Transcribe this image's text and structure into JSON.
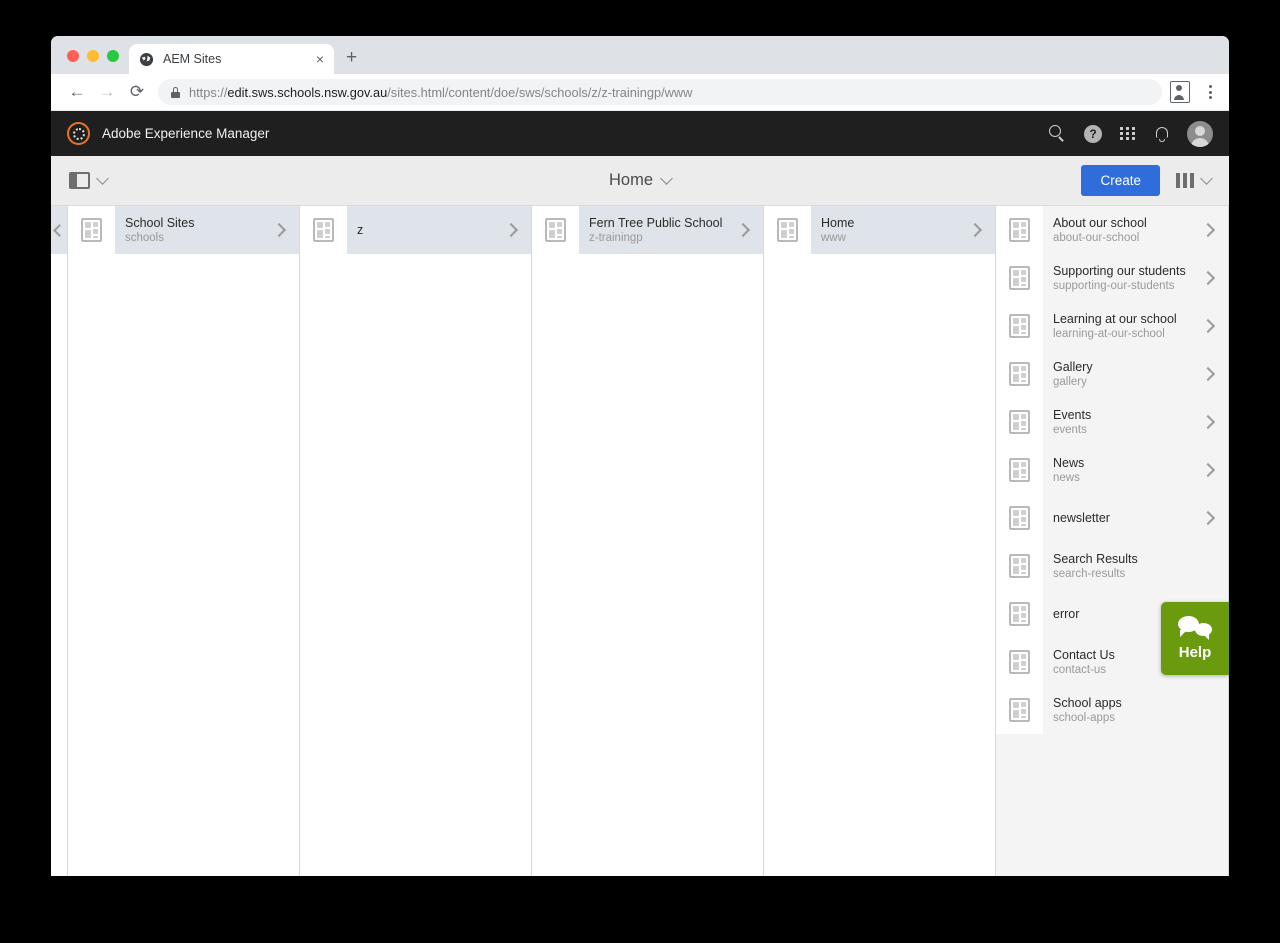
{
  "browser": {
    "tab_title": "AEM Sites",
    "tab_close_label": "×",
    "newtab_label": "+",
    "back_label": "←",
    "forward_label": "→",
    "reload_label": "⟳",
    "url_scheme": "https://",
    "url_domain": "edit.sws.schools.nsw.gov.au",
    "url_path": "/sites.html/content/doe/sws/schools/z/z-trainingp/www",
    "url_full": "https://edit.sws.schools.nsw.gov.au/sites.html/content/doe/sws/schools/z/z-trainingp/www"
  },
  "aem_header": {
    "title": "Adobe Experience Manager",
    "logo_color": "#e8732a",
    "background": "#1f1f1f",
    "icons": [
      "search-icon",
      "help-icon",
      "apps-grid-icon",
      "bell-icon",
      "user-avatar"
    ],
    "help_glyph": "?"
  },
  "toolbar": {
    "rail_toggle_label": "rail-toggle",
    "title": "Home",
    "create_label": "Create",
    "view_switch_label": "column-view"
  },
  "columns": [
    {
      "name": "schools-column",
      "rows": [
        {
          "title": "School Sites",
          "subtitle": "schools",
          "selected": true,
          "has_chevron": true
        }
      ]
    },
    {
      "name": "z-column",
      "rows": [
        {
          "title": "z",
          "subtitle": "",
          "selected": true,
          "has_chevron": true
        }
      ]
    },
    {
      "name": "school-column",
      "rows": [
        {
          "title": "Fern Tree Public School",
          "subtitle": "z-trainingp",
          "selected": true,
          "has_chevron": true
        }
      ]
    },
    {
      "name": "site-column",
      "rows": [
        {
          "title": "Home",
          "subtitle": "www",
          "selected": true,
          "has_chevron": true
        }
      ]
    }
  ],
  "page_list": {
    "name": "children-column",
    "items": [
      {
        "title": "About our school",
        "subtitle": "about-our-school",
        "has_chevron": true
      },
      {
        "title": "Supporting our students",
        "subtitle": "supporting-our-students",
        "has_chevron": true
      },
      {
        "title": "Learning at our school",
        "subtitle": "learning-at-our-school",
        "has_chevron": true
      },
      {
        "title": "Gallery",
        "subtitle": "gallery",
        "has_chevron": true
      },
      {
        "title": "Events",
        "subtitle": "events",
        "has_chevron": true
      },
      {
        "title": "News",
        "subtitle": "news",
        "has_chevron": true
      },
      {
        "title": "newsletter",
        "subtitle": "",
        "has_chevron": true
      },
      {
        "title": "Search Results",
        "subtitle": "search-results",
        "has_chevron": false
      },
      {
        "title": "error",
        "subtitle": "",
        "has_chevron": false
      },
      {
        "title": "Contact Us",
        "subtitle": "contact-us",
        "has_chevron": false
      },
      {
        "title": "School apps",
        "subtitle": "school-apps",
        "has_chevron": false
      }
    ]
  },
  "help_widget": {
    "label": "Help",
    "color": "#6a9a0e"
  }
}
